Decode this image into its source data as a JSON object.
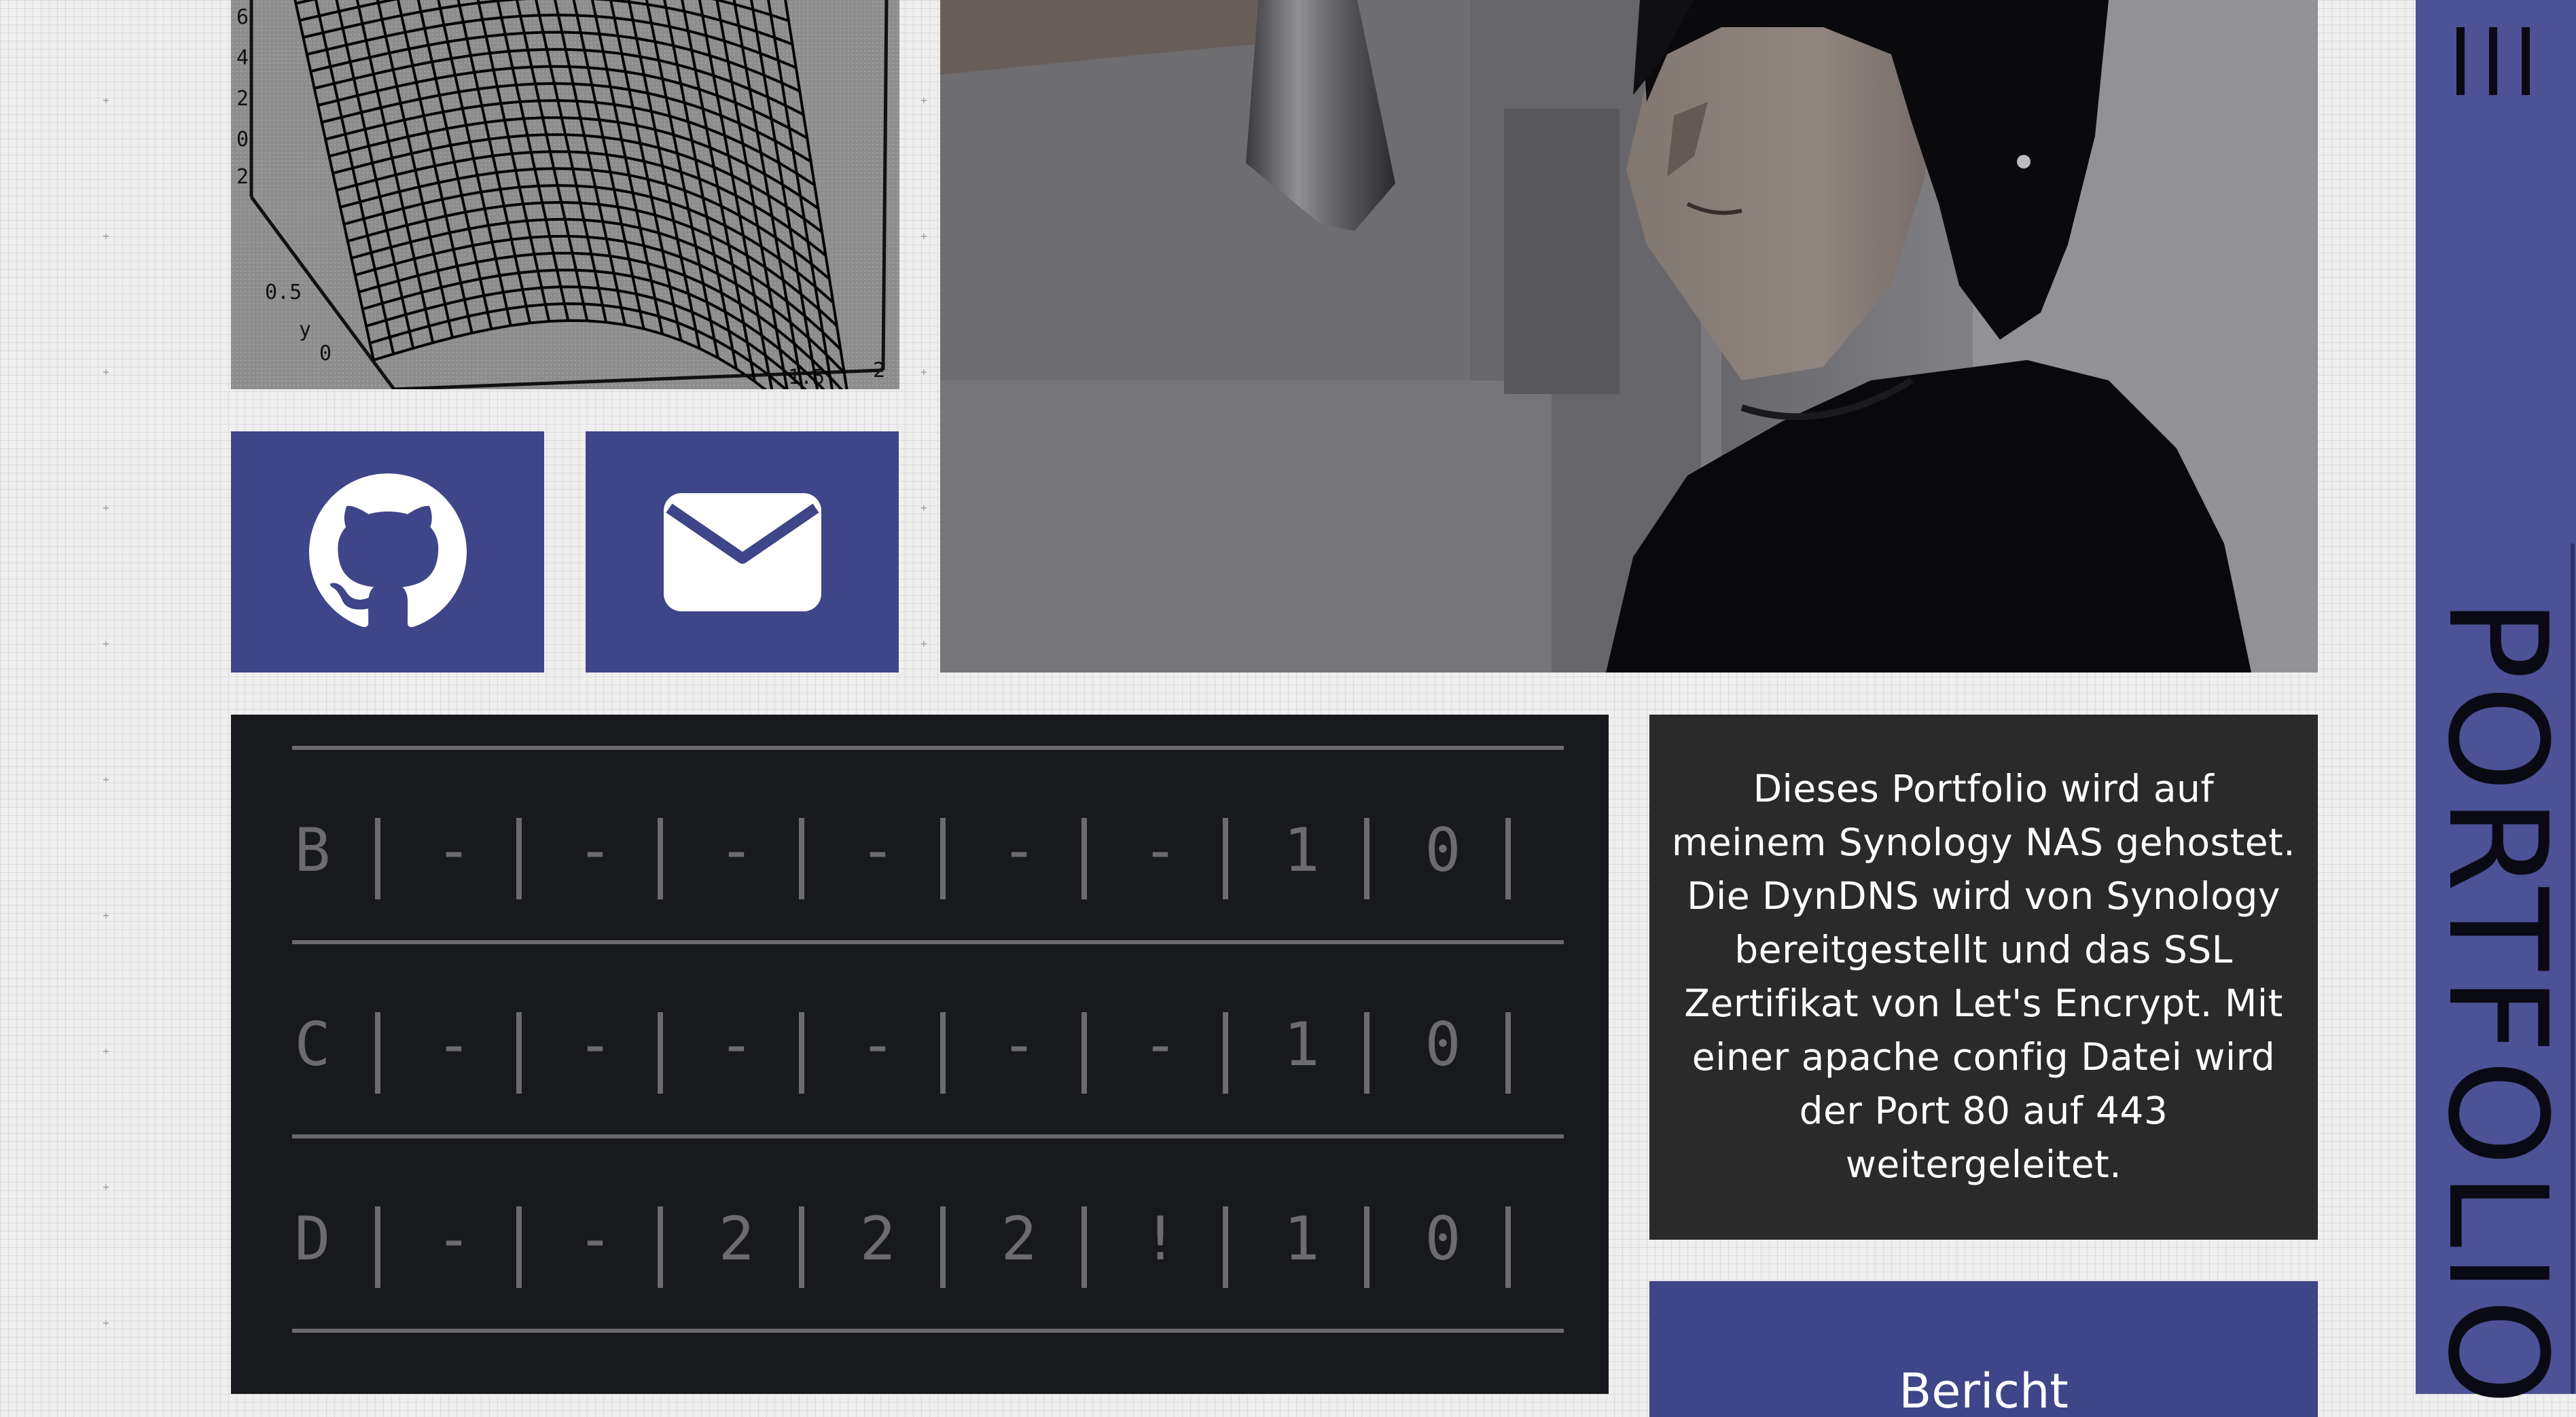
{
  "sidebar": {
    "title": "PORTFOLIO",
    "menu_icon": "hamburger-menu-icon"
  },
  "links": {
    "github_icon": "github-icon",
    "mail_icon": "envelope-icon"
  },
  "terminal": {
    "rows": [
      [
        "B",
        "-",
        "-",
        "-",
        "-",
        "-",
        "-",
        "1",
        "0"
      ],
      [
        "C",
        "-",
        "-",
        "-",
        "-",
        "-",
        "-",
        "1",
        "0"
      ],
      [
        "D",
        "-",
        "-",
        "2",
        "2",
        "2",
        "!",
        "1",
        "0"
      ]
    ]
  },
  "info": {
    "text": "Dieses Portfolio wird auf meinem Synology NAS gehostet. Die DynDNS wird von Synology bereitgestellt und das SSL Zertifikat von Let's Encrypt. Mit einer apache config Datei wird der Port 80 auf 443 weitergeleitet."
  },
  "report": {
    "title": "Bericht"
  },
  "colors": {
    "accent": "#3e4588",
    "sidebar": "#4d5196",
    "terminal_bg": "#18191c",
    "info_bg": "#2a2a2a"
  }
}
